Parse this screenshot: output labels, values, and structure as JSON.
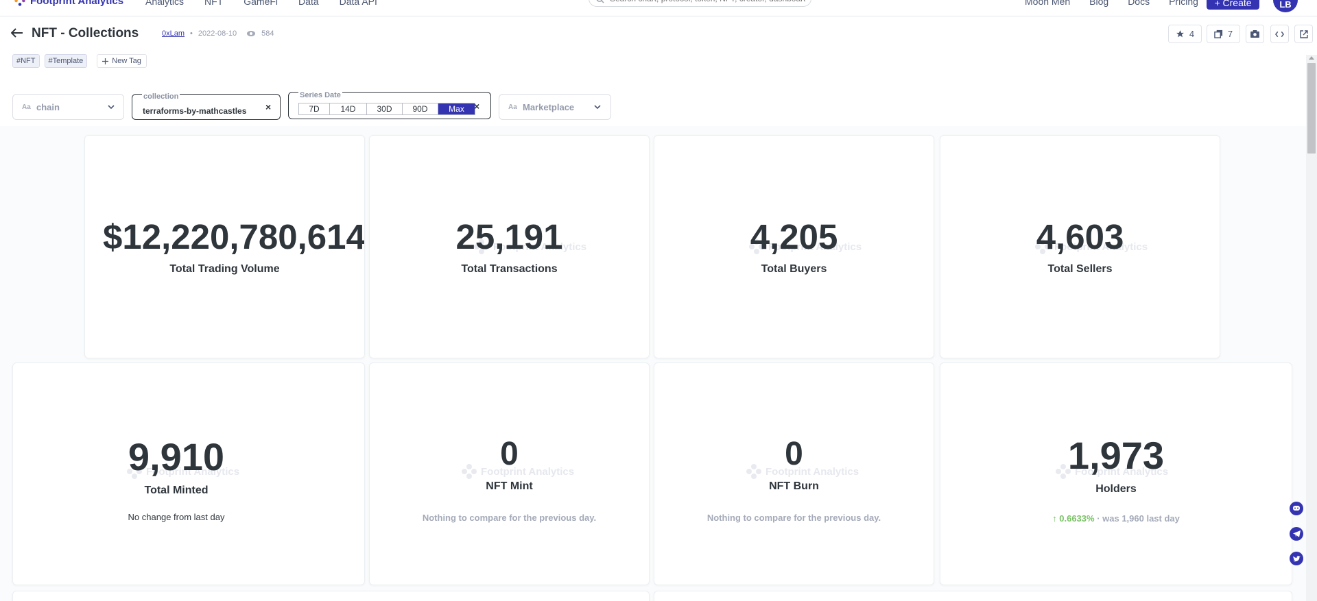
{
  "nav": {
    "logo_text": "Footprint Analytics",
    "links": [
      "Analytics",
      "NFT",
      "GameFi",
      "Data",
      "Data API"
    ],
    "search_placeholder": "Search chart, protocol, token, NFT, creator, dashboard...",
    "right_links": [
      "Moon Men",
      "Blog",
      "Docs",
      "Pricing"
    ],
    "create_label": "+ Create",
    "avatar_initials": "LB"
  },
  "header": {
    "title": "NFT - Collections",
    "author": "0xLam",
    "date": "2022-08-10",
    "views": "584",
    "tags": [
      "#NFT",
      "#Template"
    ],
    "new_tag_label": "New Tag",
    "star_count": "4",
    "copy_count": "7"
  },
  "filters": {
    "chain": {
      "label": "chain",
      "aa": "Aa"
    },
    "collection": {
      "label": "collection",
      "value": "terraforms-by-mathcastles"
    },
    "series_date": {
      "label": "Series Date",
      "options": [
        "7D",
        "14D",
        "30D",
        "90D",
        "Max"
      ],
      "selected": "Max"
    },
    "marketplace": {
      "label": "Marketplace",
      "aa": "Aa"
    }
  },
  "cards": {
    "volume": {
      "value": "$12,220,780,614",
      "label": "Total Trading Volume"
    },
    "transactions": {
      "value": "25,191",
      "label": "Total Transactions"
    },
    "buyers": {
      "value": "4,205",
      "label": "Total Buyers"
    },
    "sellers": {
      "value": "4,603",
      "label": "Total Sellers"
    },
    "minted": {
      "value": "9,910",
      "label": "Total Minted",
      "sub": "No change from last day"
    },
    "mint": {
      "value": "0",
      "label": "NFT Mint",
      "sub": "Nothing to compare for the previous day."
    },
    "burn": {
      "value": "0",
      "label": "NFT Burn",
      "sub": "Nothing to compare for the previous day."
    },
    "holders": {
      "value": "1,973",
      "label": "Holders",
      "change": "0.6633%",
      "was": " · was 1,960 last day"
    }
  },
  "watermark_text": "Footprint Analytics",
  "colors": {
    "brand": "#3434b2",
    "positive": "#7bc267"
  }
}
